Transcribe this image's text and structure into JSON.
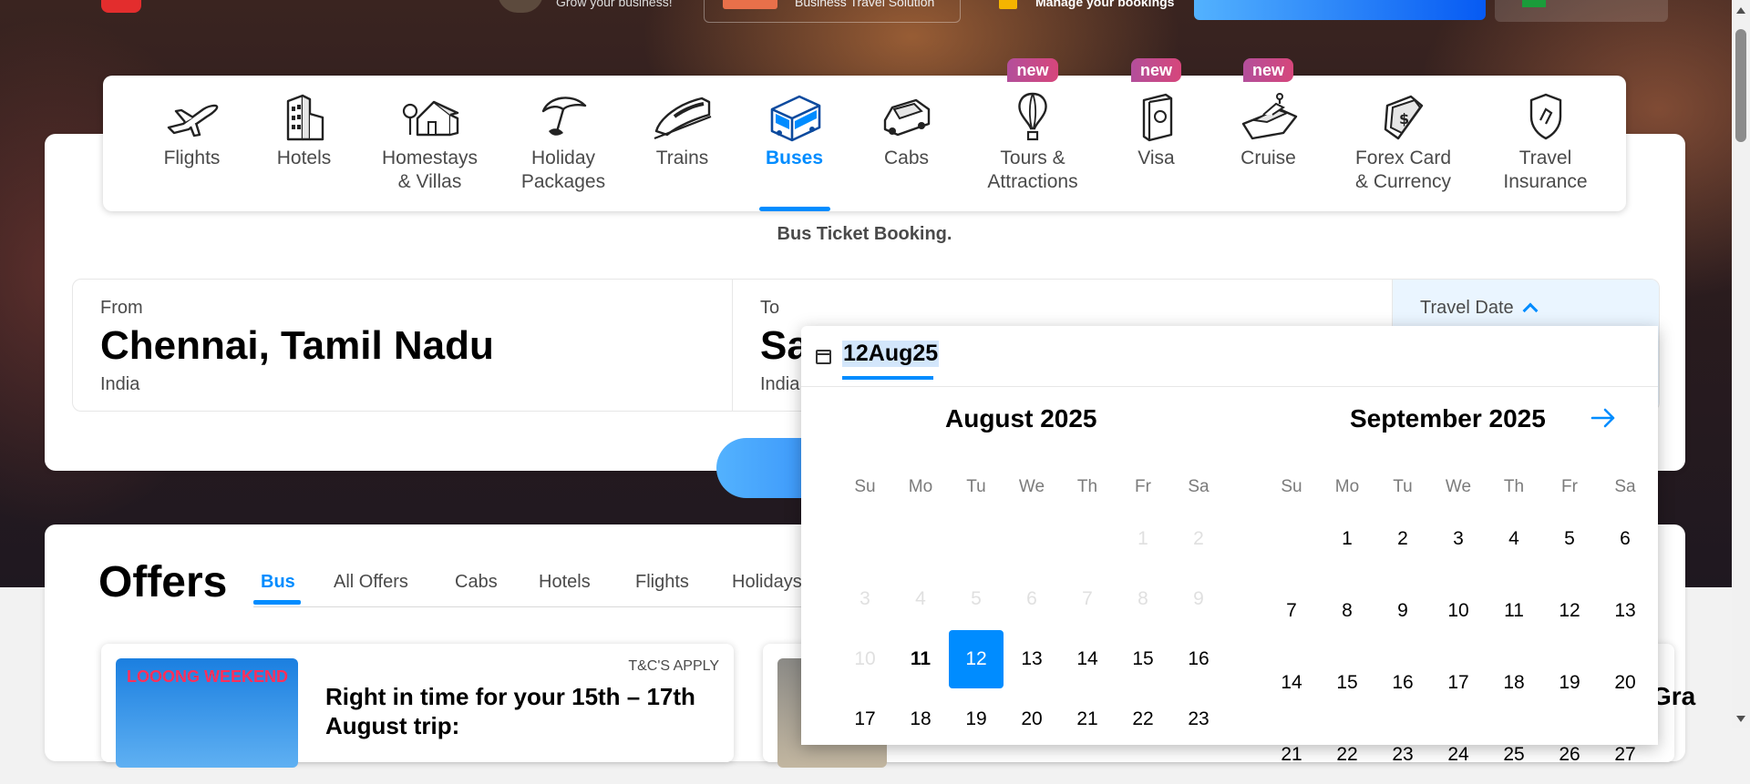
{
  "topbar": {
    "grow_text": "Grow your business!",
    "mybiz_text": "Business Travel Solution",
    "bookings_text": "Manage your bookings"
  },
  "nav": {
    "items": [
      {
        "label": "Flights",
        "icon": "plane-icon"
      },
      {
        "label": "Hotels",
        "icon": "hotel-icon"
      },
      {
        "label": "Homestays\n& Villas",
        "icon": "homestay-icon"
      },
      {
        "label": "Holiday\nPackages",
        "icon": "umbrella-icon"
      },
      {
        "label": "Trains",
        "icon": "train-icon"
      },
      {
        "label": "Buses",
        "icon": "bus-icon",
        "active": true
      },
      {
        "label": "Cabs",
        "icon": "cab-icon"
      },
      {
        "label": "Tours &\nAttractions",
        "icon": "balloon-icon",
        "badge": "new"
      },
      {
        "label": "Visa",
        "icon": "passport-icon",
        "badge": "new"
      },
      {
        "label": "Cruise",
        "icon": "ship-icon",
        "badge": "new"
      },
      {
        "label": "Forex Card\n& Currency",
        "icon": "forex-icon"
      },
      {
        "label": "Travel\nInsurance",
        "icon": "shield-icon"
      }
    ],
    "badge_text": "new"
  },
  "search": {
    "subtitle": "Bus Ticket Booking.",
    "from": {
      "label": "From",
      "value": "Chennai, Tamil Nadu",
      "sub": "India"
    },
    "to": {
      "label": "To",
      "value": "Sa",
      "sub": "India"
    },
    "date": {
      "label": "Travel Date"
    }
  },
  "calendar": {
    "input_value": "12Aug25",
    "months": [
      {
        "title": "August 2025"
      },
      {
        "title": "September 2025"
      }
    ],
    "weekdays": [
      "Su",
      "Mo",
      "Tu",
      "We",
      "Th",
      "Fr",
      "Sa"
    ]
  },
  "offers": {
    "title": "Offers",
    "tabs": [
      "Bus",
      "All Offers",
      "Cabs",
      "Hotels",
      "Flights",
      "Holidays"
    ],
    "active_tab": "Bus",
    "card1": {
      "tnc": "T&C'S APPLY",
      "text": "Right in time for your 15th – 17th August trip:",
      "image_text": "LOOONG WEEKEND"
    },
    "card2": {
      "partial_text": "Gra"
    }
  },
  "colors": {
    "accent": "#008cff",
    "badge": "#c04b8d"
  }
}
